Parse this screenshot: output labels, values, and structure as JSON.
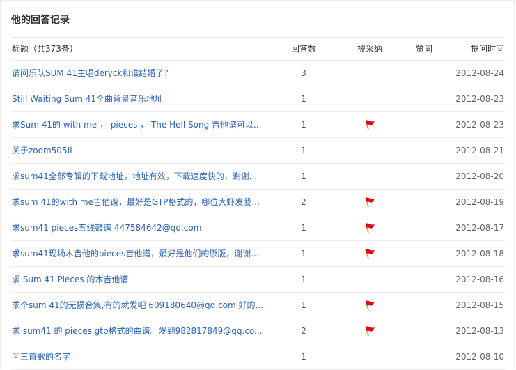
{
  "panel": {
    "title": "他的回答记录"
  },
  "table": {
    "headers": {
      "title": "标题（共373条）",
      "answer_count": "回答数",
      "adopted": "被采纳",
      "agree": "赞同",
      "time": "提问时间"
    },
    "rows": [
      {
        "title": "请问乐队SUM 41主唱deryck和谁结婚了？",
        "answer_count": "3",
        "adopted": false,
        "agree": "",
        "time": "2012-08-24"
      },
      {
        "title": "Still Waiting Sum 41全曲背景音乐地址",
        "answer_count": "1",
        "adopted": false,
        "agree": "",
        "time": "2012-08-23"
      },
      {
        "title": "求Sum 41的  with me ，  pieces ，  The Hell Song 吉他谱可以...",
        "answer_count": "1",
        "adopted": true,
        "agree": "",
        "time": "2012-08-23"
      },
      {
        "title": "关于zoom505II",
        "answer_count": "1",
        "adopted": false,
        "agree": "",
        "time": "2012-08-21"
      },
      {
        "title": "求sum41全部专辑的下载地址，地址有效，下载速度快的，谢谢...",
        "answer_count": "1",
        "adopted": false,
        "agree": "",
        "time": "2012-08-20"
      },
      {
        "title": "求sum 41的with me吉他谱，最好是GTP格式的，哪位大虾发我...",
        "answer_count": "2",
        "adopted": true,
        "agree": "",
        "time": "2012-08-19"
      },
      {
        "title": "求sum41 pieces五线鼓谱  447584642@qq.com",
        "answer_count": "1",
        "adopted": true,
        "agree": "",
        "time": "2012-08-17"
      },
      {
        "title": "求sum41现场木吉他的pieces吉他谱，最好是他们的原版，谢谢...",
        "answer_count": "1",
        "adopted": true,
        "agree": "",
        "time": "2012-08-18"
      },
      {
        "title": "求  Sum 41 Pieces 的木吉他谱",
        "answer_count": "1",
        "adopted": false,
        "agree": "",
        "time": "2012-08-16"
      },
      {
        "title": "求个sum 41的无损合集,有的就发吧  609180640@qq.com 好的...",
        "answer_count": "1",
        "adopted": true,
        "agree": "",
        "time": "2012-08-15"
      },
      {
        "title": "求  sum41 的  pieces gtp格式的曲谱。发到982817849@qq.co...",
        "answer_count": "2",
        "adopted": true,
        "agree": "",
        "time": "2012-08-13"
      },
      {
        "title": "问三首歌的名字",
        "answer_count": "1",
        "adopted": false,
        "agree": "",
        "time": "2012-08-10"
      }
    ]
  },
  "icons": {
    "adopted": "red-flag-icon"
  },
  "colors": {
    "link": "#2d64b3",
    "flag_red": "#e60012",
    "flag_pole": "#d4a017",
    "rule": "#ececec"
  }
}
